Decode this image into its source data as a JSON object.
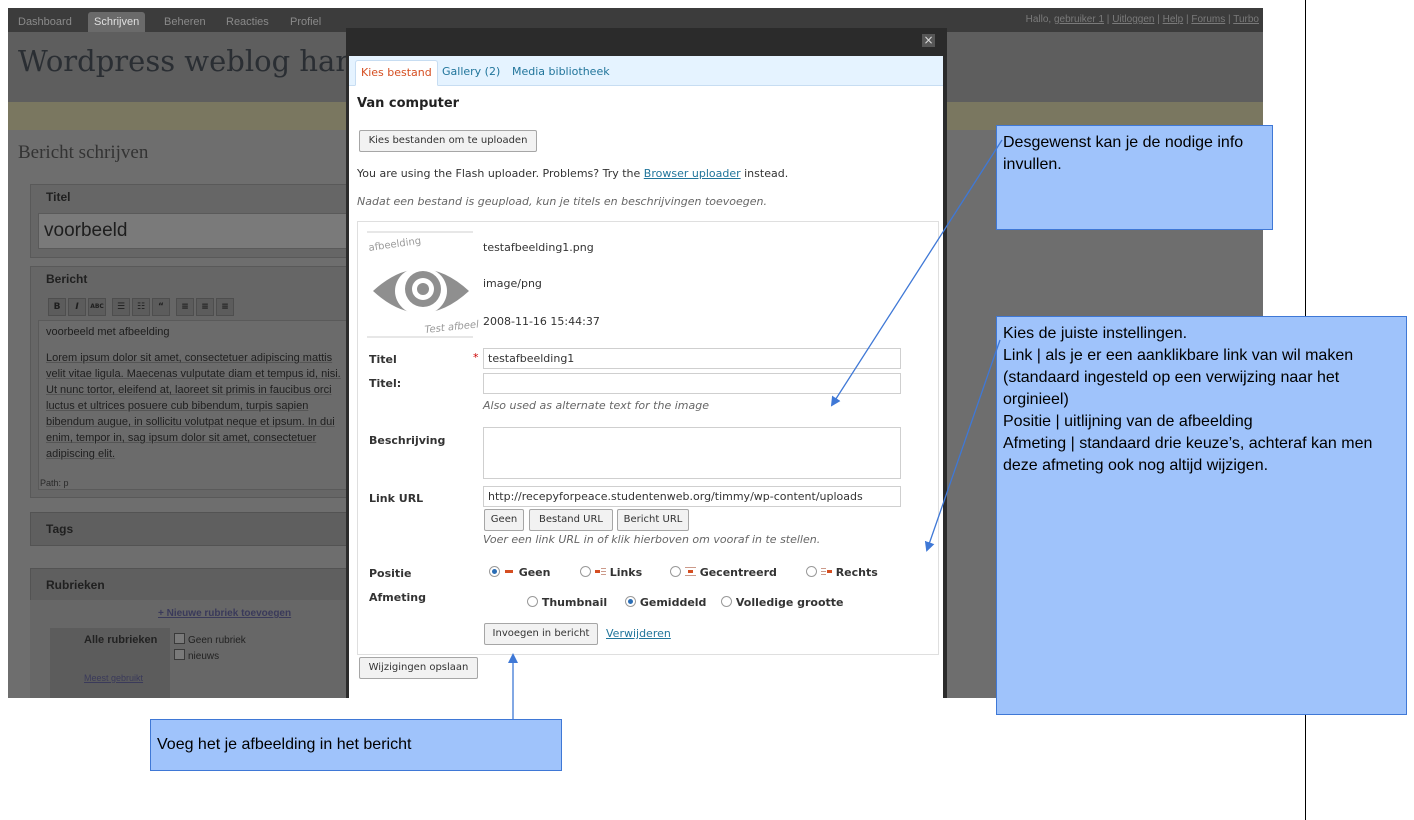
{
  "wp": {
    "nav_tabs": [
      "Dashboard",
      "Schrijven",
      "Beheren",
      "Reacties",
      "Profiel"
    ],
    "user_links": {
      "greeting": "Hallo,",
      "user": "gebruiker 1",
      "logout": "Uitloggen",
      "help": "Help",
      "forums": "Forums",
      "turbo": "Turbo"
    },
    "site_title": "Wordpress weblog han",
    "page_title": "Bericht schrijven",
    "title_label": "Titel",
    "title_value": "voorbeeld",
    "body_label": "Bericht",
    "toolbar": [
      "B",
      "I",
      "ABC",
      "☰",
      "☷",
      "“",
      "≡",
      "≡",
      "≡"
    ],
    "editor_line": "voorbeeld met afbeelding",
    "editor_lorem": "Lorem ipsum dolor sit amet, consectetuer adipiscing mattis velit vitae ligula. Maecenas vulputate diam et tempus id, nisi. Ut nunc tortor, eleifend at, laoreet sit primis in faucibus orci luctus et ultrices posuere cub bibendum, turpis sapien bibendum augue, in sollicitu volutpat neque et ipsum. In dui enim, tempor in, sag ipsum dolor sit amet, consectetuer adipiscing elit.",
    "path": "Path: p",
    "tags_label": "Tags",
    "rubrieken_label": "Rubrieken",
    "new_rubriek": "+ Nieuwe rubriek toevoegen",
    "alle_rubrieken": "Alle rubrieken",
    "meest_gebruikt": "Meest gebruikt",
    "rubriek_options": [
      "Geen rubriek",
      "nieuws"
    ]
  },
  "modal": {
    "close": "×",
    "tabs": [
      "Kies bestand",
      "Gallery (2)",
      "Media bibliotheek"
    ],
    "heading": "Van computer",
    "choose_button": "Kies bestanden om te uploaden",
    "flash_text_1": "You are using the Flash uploader. Problems? Try the",
    "flash_link": "Browser uploader",
    "flash_text_2": "instead.",
    "after_upload_hint": "Nadat een bestand is geupload, kun je titels en beschrijvingen toevoegen.",
    "thumb_label_top": "afbeelding",
    "thumb_label_bottom": "Test afbeel",
    "file_name": "testafbeelding1.png",
    "file_type": "image/png",
    "file_date": "2008-11-16 15:44:37",
    "fields": {
      "title_label": "Titel",
      "required_mark": "*",
      "title_value": "testafbeelding1",
      "alt_label": "Titel:",
      "alt_value": "",
      "alt_hint": "Also used as alternate text for the image",
      "desc_label": "Beschrijving",
      "desc_value": "",
      "link_label": "Link URL",
      "link_value": "http://recepyforpeace.studentenweb.org/timmy/wp-content/uploads",
      "link_buttons": [
        "Geen",
        "Bestand URL",
        "Bericht URL"
      ],
      "link_hint": "Voer een link URL in of klik hierboven om vooraf in te stellen.",
      "position_label": "Positie",
      "position_options": [
        "Geen",
        "Links",
        "Gecentreerd",
        "Rechts"
      ],
      "position_selected": "Geen",
      "size_label": "Afmeting",
      "size_options": [
        "Thumbnail",
        "Gemiddeld",
        "Volledige grootte"
      ],
      "size_selected": "Gemiddeld"
    },
    "insert_button": "Invoegen in bericht",
    "delete_link": "Verwijderen",
    "save_button": "Wijzigingen opslaan"
  },
  "callouts": {
    "info": "Desgewenst kan je de nodige info invullen.",
    "settings": "Kies de juiste instellingen.\nLink | als je er een aanklikbare link van wil maken (standaard ingesteld op een verwijzing naar het orginieel)\nPositie | uitlijning van de afbeelding\nAfmeting | standaard drie keuze’s, achteraf kan men deze afmeting ook nog altijd wijzigen.",
    "insert": "Voeg het je afbeelding in het bericht"
  },
  "colors": {
    "accent_link": "#21759b",
    "active_tab": "#d54e21",
    "callout_fill": "#9fc3fb",
    "callout_border": "#3f78d6"
  },
  "icons": [
    "close-icon",
    "required-star-icon",
    "eye-thumbnail-icon",
    "align-none-icon",
    "align-left-icon",
    "align-center-icon",
    "align-right-icon",
    "arrow-icon"
  ]
}
